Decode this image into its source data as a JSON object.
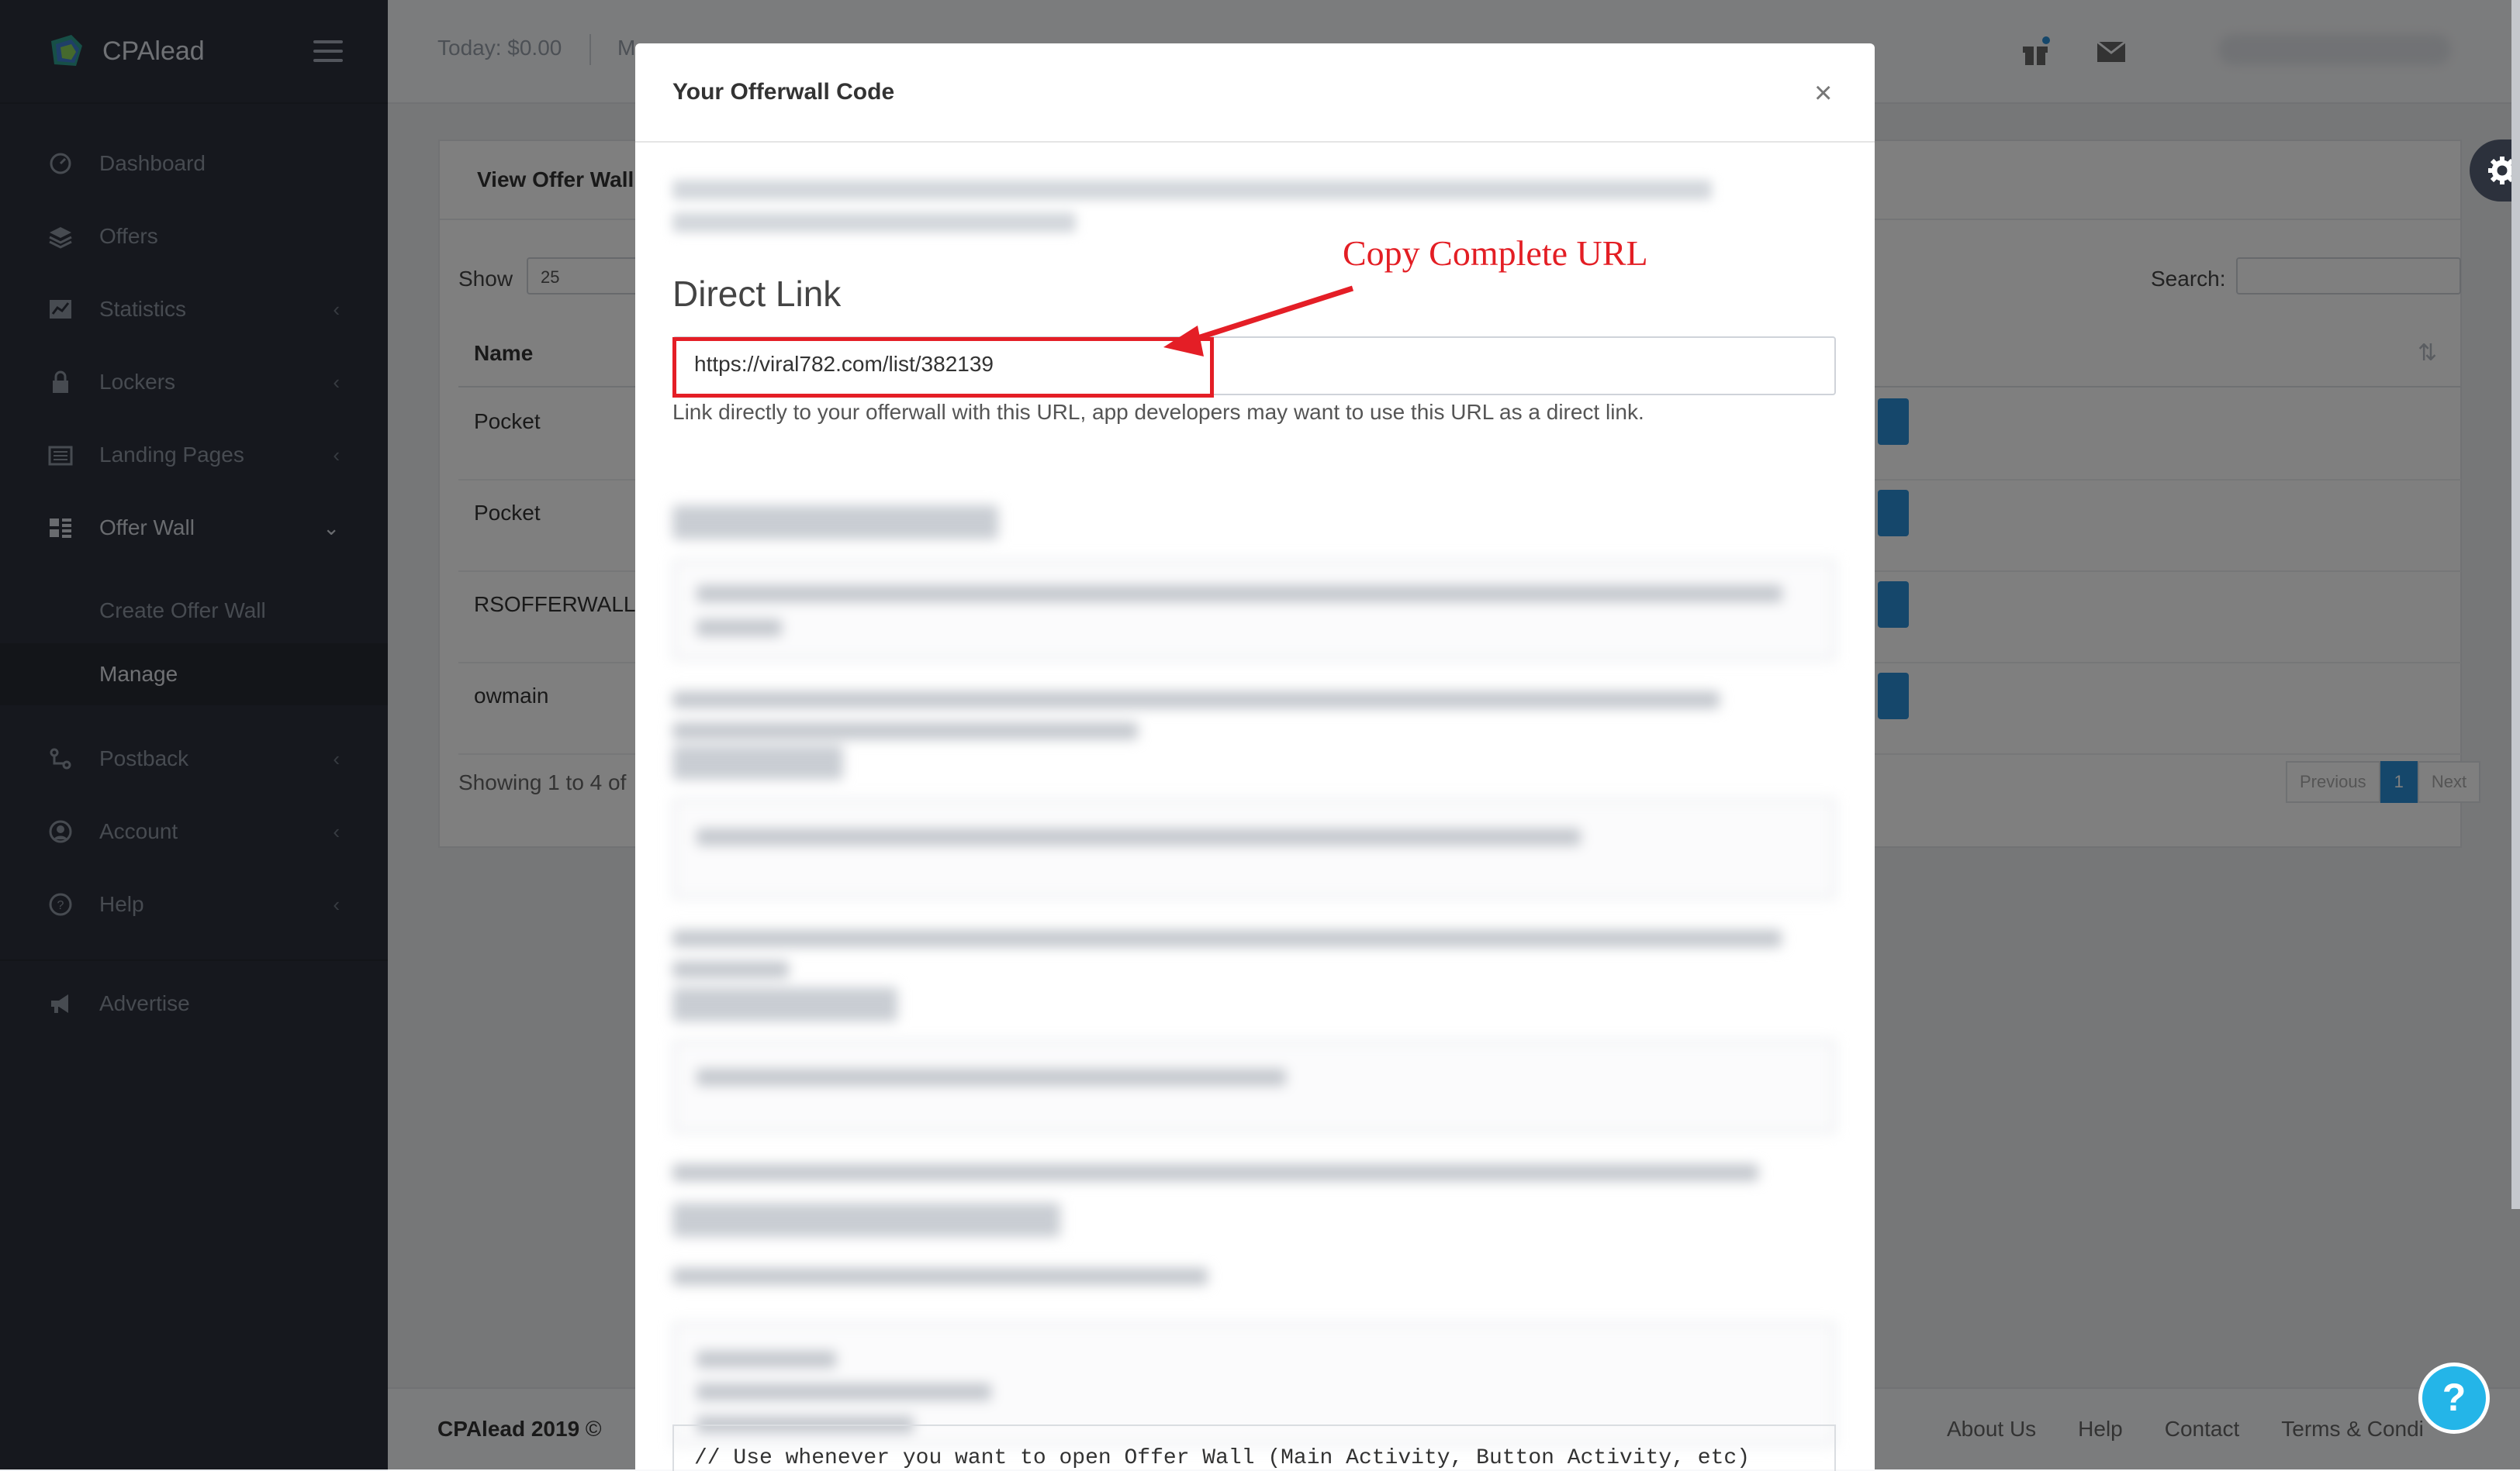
{
  "app": {
    "name": "CPAlead"
  },
  "topbar": {
    "today": "Today: $0.00",
    "month": "M"
  },
  "sidebar": {
    "items": [
      {
        "label": "Dashboard",
        "icon": "dashboard-icon"
      },
      {
        "label": "Offers",
        "icon": "layers-icon"
      },
      {
        "label": "Statistics",
        "icon": "chart-icon"
      },
      {
        "label": "Lockers",
        "icon": "lock-icon"
      },
      {
        "label": "Landing Pages",
        "icon": "newspaper-icon"
      },
      {
        "label": "Offer Wall",
        "icon": "grid-icon"
      },
      {
        "label": "Postback",
        "icon": "postback-icon"
      },
      {
        "label": "Account",
        "icon": "user-circle-icon"
      },
      {
        "label": "Help",
        "icon": "help-icon"
      },
      {
        "label": "Advertise",
        "icon": "megaphone-icon"
      }
    ],
    "subitems": [
      {
        "label": "Create Offer Wall"
      },
      {
        "label": "Manage"
      }
    ]
  },
  "panel": {
    "title": "View Offer Wall",
    "show_label": "Show",
    "page_size": "25",
    "search_label": "Search:",
    "column_name": "Name",
    "rows": [
      "Pocket",
      "Pocket",
      "RSOFFERWALL",
      "owmain"
    ],
    "showing": "Showing 1 to 4 of",
    "pager": {
      "previous": "Previous",
      "current": "1",
      "next": "Next"
    }
  },
  "footer": {
    "copyright": "CPAlead 2019",
    "copyright_symbol": "©",
    "links": [
      "About Us",
      "Help",
      "Contact",
      "Terms & Condi"
    ]
  },
  "modal": {
    "title": "Your Offerwall Code",
    "close": "×",
    "direct_link_heading": "Direct Link",
    "direct_link_url": "https://viral782.com/list/382139",
    "direct_link_help": "Link directly to your offerwall with this URL, app developers may want to use this URL as a direct link.",
    "code_line": "// Use whenever you want to open Offer Wall (Main Activity, Button Activity, etc)"
  },
  "annotation": {
    "text": "Copy Complete URL",
    "color": "#e31e24"
  },
  "help_button": "?",
  "colors": {
    "sidebar_bg": "#2c313c",
    "accent": "#2b8ed6",
    "help_fab": "#24b5e8"
  }
}
